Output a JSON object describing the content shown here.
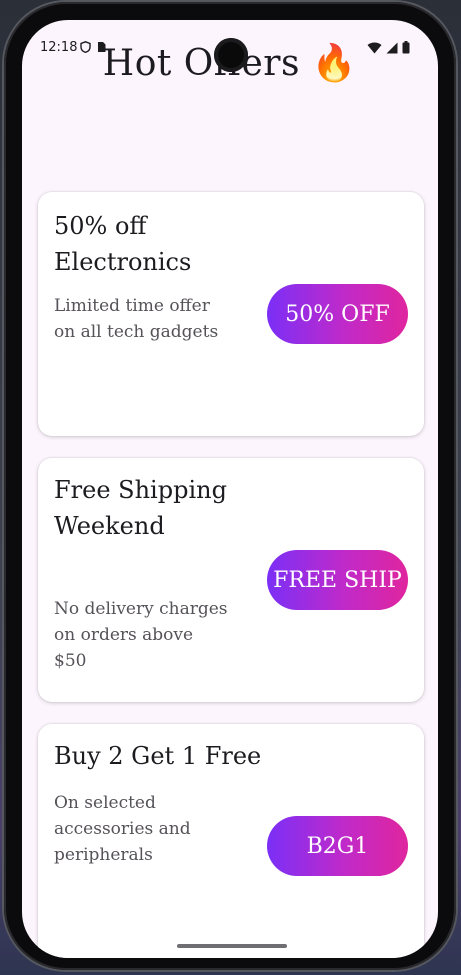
{
  "status_bar": {
    "time": "12:18",
    "icons": [
      "shield-icon",
      "sim-card-icon",
      "wifi-icon",
      "signal-icon",
      "battery-icon"
    ]
  },
  "header": {
    "title": "Hot Offers 🔥"
  },
  "offers": [
    {
      "title": "50% off Electronics",
      "description": "Limited time offer on all tech gadgets",
      "badge": "50% OFF"
    },
    {
      "title": "Free Shipping Weekend",
      "description": "No delivery charges on orders above $50",
      "badge": "FREE SHIP"
    },
    {
      "title": "Buy 2 Get 1 Free",
      "description": "On selected accessories and peripherals",
      "badge": "B2G1"
    }
  ],
  "colors": {
    "screen_background": "#fdf5fd",
    "badge_gradient_start": "#7b2ff7",
    "badge_gradient_end": "#e0259e"
  }
}
